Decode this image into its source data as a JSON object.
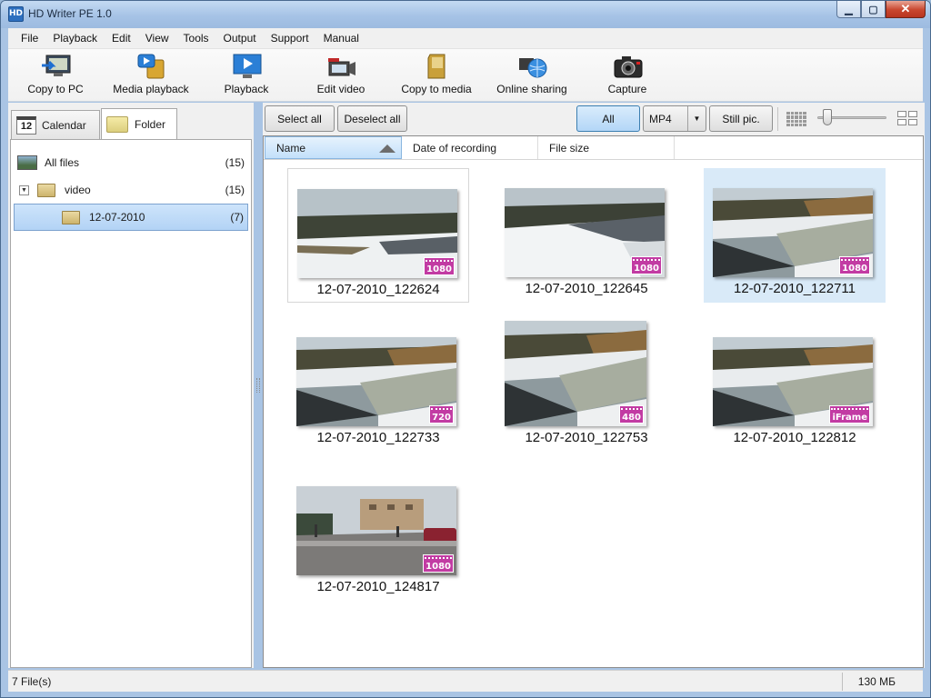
{
  "window": {
    "title": "HD Writer PE 1.0",
    "app_icon_text": "HD"
  },
  "menu": [
    "File",
    "Playback",
    "Edit",
    "View",
    "Tools",
    "Output",
    "Support",
    "Manual"
  ],
  "toolbar": {
    "copy_to_pc": "Copy to PC",
    "media_playback": "Media playback",
    "playback": "Playback",
    "edit_video": "Edit video",
    "copy_to_media": "Copy to media",
    "online_sharing": "Online sharing",
    "capture": "Capture"
  },
  "tabs": {
    "calendar": "Calendar",
    "calendar_day": "12",
    "folder": "Folder"
  },
  "tree": [
    {
      "label": "All files",
      "count": "(15)"
    },
    {
      "label": "video",
      "count": "(15)"
    },
    {
      "label": "12-07-2010",
      "count": "(7)"
    }
  ],
  "filterbar": {
    "select_all": "Select all",
    "deselect_all": "Deselect all",
    "all": "All",
    "format_value": "MP4",
    "still_pic": "Still pic."
  },
  "columns": {
    "name": "Name",
    "date": "Date of recording",
    "size": "File size"
  },
  "thumbnails": [
    {
      "name": "12-07-2010_122624",
      "badge": "1080"
    },
    {
      "name": "12-07-2010_122645",
      "badge": "1080"
    },
    {
      "name": "12-07-2010_122711",
      "badge": "1080"
    },
    {
      "name": "12-07-2010_122733",
      "badge": "720"
    },
    {
      "name": "12-07-2010_122753",
      "badge": "480"
    },
    {
      "name": "12-07-2010_122812",
      "badge": "iFrame"
    },
    {
      "name": "12-07-2010_124817",
      "badge": "1080"
    }
  ],
  "status": {
    "files": "7 File(s)",
    "size": "130 МБ"
  },
  "colors": {
    "selection": "#cde4fb",
    "badge": "#c23ba3",
    "titlebar": "#a6c3e6"
  }
}
